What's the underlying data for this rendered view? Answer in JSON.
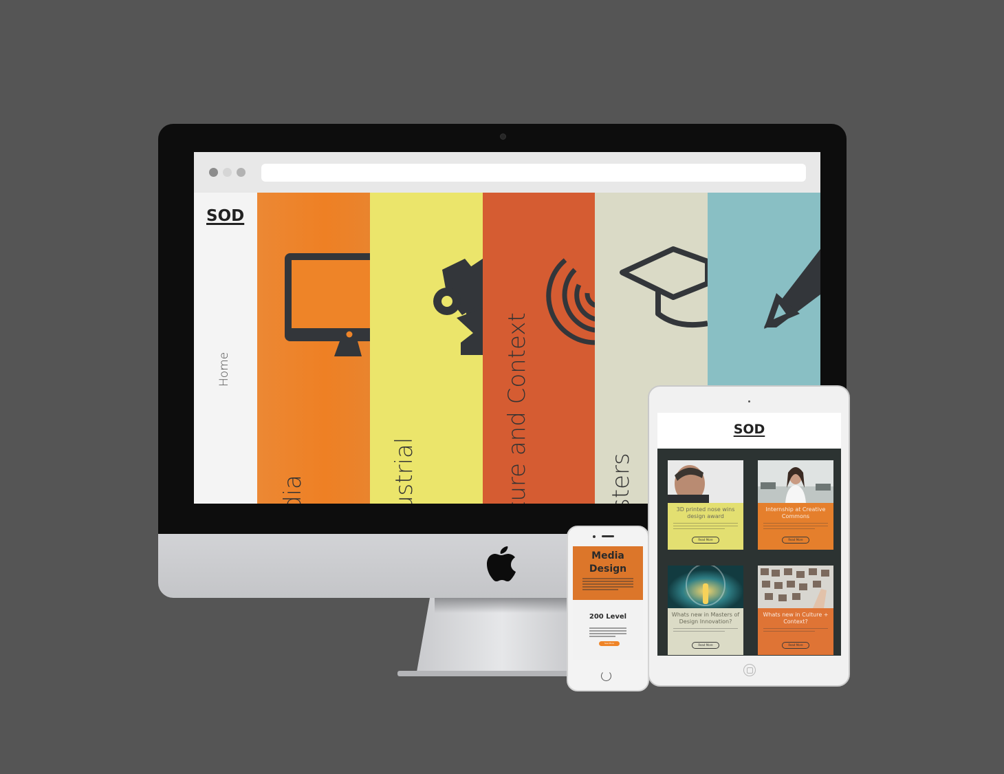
{
  "desktop": {
    "logo": "SOD",
    "nav_home": "Home",
    "panels": [
      {
        "label": "dia",
        "icon": "monitor-icon",
        "color": "#ee8428"
      },
      {
        "label": "ustrial",
        "icon": "robot-arm-icon",
        "color": "#ebe56b"
      },
      {
        "label": "ture and Context",
        "icon": "spiral-icon",
        "color": "#d55c32"
      },
      {
        "label": "sters",
        "icon": "graduation-cap-icon",
        "color": "#dadac6"
      },
      {
        "label": "",
        "icon": "pencil-icon",
        "color": "#89bfc4"
      }
    ]
  },
  "phone": {
    "hero_title_line1": "Media",
    "hero_title_line2": "Design",
    "level": "200 Level",
    "button": "See More"
  },
  "tablet": {
    "logo": "SOD",
    "cards": [
      {
        "title": "3D printed nose wins design award",
        "button": "Read More",
        "color": "#e3df71"
      },
      {
        "title": "Internship at Creative Commons",
        "button": "Read More",
        "color": "#e57f2c"
      },
      {
        "title": "Whats new in Masters of Design Innovation?",
        "button": "Read More",
        "color": "#dbdbc6"
      },
      {
        "title": "Whats new in Culture + Context?",
        "button": "Read More",
        "color": "#df7435"
      }
    ]
  }
}
